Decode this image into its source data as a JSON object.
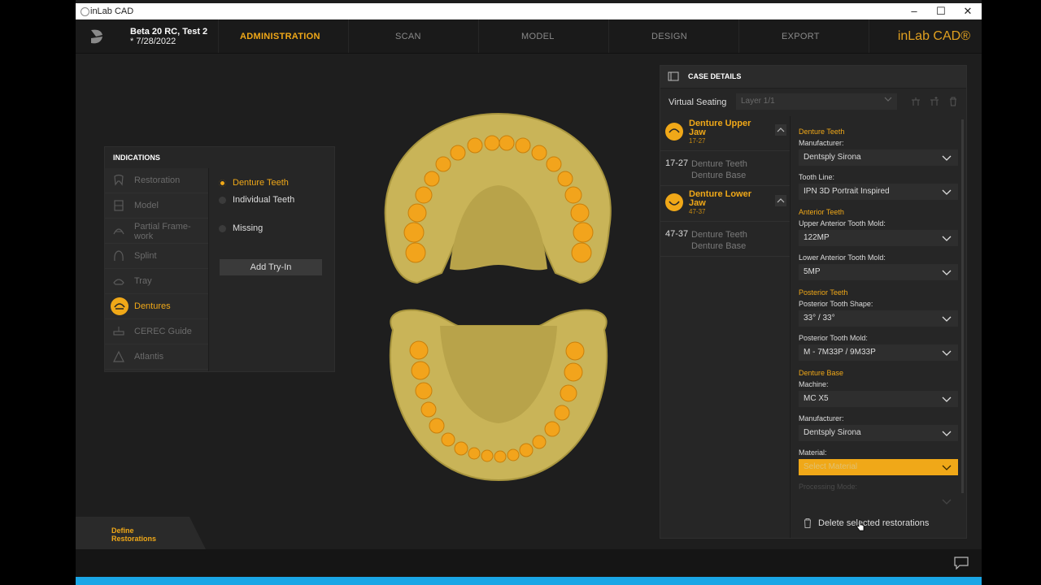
{
  "window": {
    "title": "inLab CAD",
    "minimize": "–",
    "maximize": "☐",
    "close": "✕"
  },
  "header": {
    "case_title": "Beta 20 RC, Test 2",
    "case_date": "* 7/28/2022",
    "steps": [
      "ADMINISTRATION",
      "SCAN",
      "MODEL",
      "DESIGN",
      "EXPORT"
    ],
    "active_step": "ADMINISTRATION",
    "brand": "inLab CAD®"
  },
  "indications": {
    "title": "INDICATIONS",
    "items": [
      "Restoration",
      "Model",
      "Partial Frame-work",
      "Splint",
      "Tray",
      "Dentures",
      "CEREC Guide",
      "Atlantis"
    ],
    "active_item": "Dentures",
    "options": [
      "Denture Teeth",
      "Individual Teeth",
      "Missing"
    ],
    "selected_option": "Denture Teeth",
    "add_button": "Add Try-In"
  },
  "case_details": {
    "title": "CASE DETAILS",
    "virtual_seating_label": "Virtual Seating",
    "layer_value": "Layer 1/1",
    "jaws": [
      {
        "name": "Denture Upper Jaw",
        "range": "17-27",
        "row_num": "17-27",
        "row_line1": "Denture Teeth",
        "row_line2": "Denture Base"
      },
      {
        "name": "Denture Lower Jaw",
        "range": "47-37",
        "row_num": "47-37",
        "row_line1": "Denture Teeth",
        "row_line2": "Denture Base"
      }
    ],
    "form": {
      "sec_denture_teeth": "Denture Teeth",
      "manufacturer_label": "Manufacturer:",
      "manufacturer_value": "Dentsply Sirona",
      "tooth_line_label": "Tooth Line:",
      "tooth_line_value": "IPN 3D Portrait Inspired",
      "sec_anterior": "Anterior Teeth",
      "upper_ant_label": "Upper Anterior Tooth Mold:",
      "upper_ant_value": "122MP",
      "lower_ant_label": "Lower Anterior Tooth Mold:",
      "lower_ant_value": "5MP",
      "sec_posterior": "Posterior Teeth",
      "post_shape_label": "Posterior Tooth Shape:",
      "post_shape_value": "33° / 33°",
      "post_mold_label": "Posterior Tooth Mold:",
      "post_mold_value": "M - 7M33P / 9M33P",
      "sec_base": "Denture Base",
      "machine_label": "Machine:",
      "machine_value": "MC X5",
      "base_manufacturer_label": "Manufacturer:",
      "base_manufacturer_value": "Dentsply Sirona",
      "material_label": "Material:",
      "material_placeholder": "Select Material",
      "processing_label": "Processing Mode:"
    },
    "delete_label": "Delete selected restorations"
  },
  "bottom": {
    "define_label_1": "Define",
    "define_label_2": "Restorations"
  },
  "colors": {
    "accent": "#f0a818",
    "model": "#c9b458",
    "teeth": "#f2a41c",
    "background": "#1e1e1e",
    "taskbar": "#1aa6e6"
  }
}
